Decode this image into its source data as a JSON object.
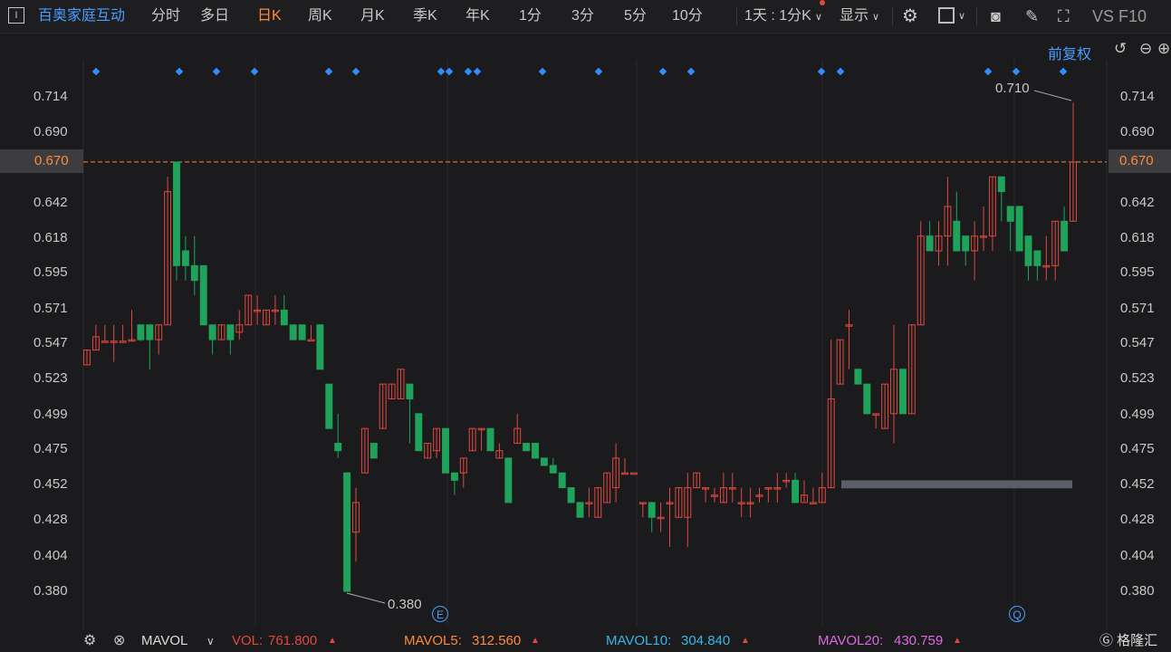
{
  "toolbar": {
    "stock_name": "百奥家庭互动",
    "tabs": [
      "分时",
      "多日",
      "日K",
      "周K",
      "月K",
      "季K",
      "年K",
      "1分",
      "3分",
      "5分",
      "10分"
    ],
    "active_tab": "日K",
    "interval_select": "1天 : 1分K",
    "display_menu": "显示",
    "right_label": "VS F10"
  },
  "chart_header": {
    "adjust_mode": "前复权"
  },
  "price_axis": {
    "ticks": [
      "0.714",
      "0.690",
      "0.670",
      "0.642",
      "0.618",
      "0.595",
      "0.571",
      "0.547",
      "0.523",
      "0.499",
      "0.475",
      "0.452",
      "0.428",
      "0.404",
      "0.380"
    ],
    "current_price": "0.670"
  },
  "annotations": {
    "max_label": "0.710",
    "min_label": "0.380",
    "marker_e": "E",
    "marker_q": "Q"
  },
  "status_bar": {
    "indicator": "MAVOL",
    "vol_label": "VOL:",
    "vol_value": "761.800",
    "mavol5_label": "MAVOL5:",
    "mavol5_value": "312.560",
    "mavol10_label": "MAVOL10:",
    "mavol10_value": "304.840",
    "mavol20_label": "MAVOL20:",
    "mavol20_value": "430.759"
  },
  "watermark": "格隆汇",
  "colors": {
    "up": "#e0483e",
    "down": "#1fa35a",
    "accent": "#2f8fff",
    "current_line": "#ff8a3d"
  },
  "chart_data": {
    "type": "candlestick",
    "ylim": [
      0.37,
      0.725
    ],
    "ohlc": [
      [
        0.533,
        0.543,
        0.543,
        0.533
      ],
      [
        0.543,
        0.56,
        0.552,
        0.543
      ],
      [
        0.549,
        0.56,
        0.549,
        0.549
      ],
      [
        0.549,
        0.56,
        0.549,
        0.535
      ],
      [
        0.549,
        0.56,
        0.549,
        0.549
      ],
      [
        0.549,
        0.57,
        0.55,
        0.549
      ],
      [
        0.56,
        0.56,
        0.55,
        0.549
      ],
      [
        0.56,
        0.56,
        0.55,
        0.53
      ],
      [
        0.55,
        0.56,
        0.56,
        0.54
      ],
      [
        0.56,
        0.66,
        0.65,
        0.56
      ],
      [
        0.67,
        0.67,
        0.6,
        0.59
      ],
      [
        0.61,
        0.62,
        0.6,
        0.59
      ],
      [
        0.6,
        0.62,
        0.59,
        0.58
      ],
      [
        0.6,
        0.6,
        0.56,
        0.56
      ],
      [
        0.56,
        0.56,
        0.55,
        0.54
      ],
      [
        0.55,
        0.56,
        0.56,
        0.55
      ],
      [
        0.56,
        0.56,
        0.55,
        0.54
      ],
      [
        0.555,
        0.57,
        0.56,
        0.55
      ],
      [
        0.56,
        0.58,
        0.58,
        0.56
      ],
      [
        0.57,
        0.58,
        0.57,
        0.56
      ],
      [
        0.56,
        0.57,
        0.57,
        0.56
      ],
      [
        0.57,
        0.58,
        0.57,
        0.56
      ],
      [
        0.57,
        0.58,
        0.56,
        0.56
      ],
      [
        0.56,
        0.56,
        0.55,
        0.55
      ],
      [
        0.56,
        0.56,
        0.55,
        0.55
      ],
      [
        0.55,
        0.56,
        0.55,
        0.55
      ],
      [
        0.56,
        0.56,
        0.53,
        0.53
      ],
      [
        0.52,
        0.52,
        0.49,
        0.49
      ],
      [
        0.48,
        0.5,
        0.475,
        0.47
      ],
      [
        0.46,
        0.46,
        0.38,
        0.38
      ],
      [
        0.42,
        0.45,
        0.44,
        0.4
      ],
      [
        0.46,
        0.49,
        0.49,
        0.46
      ],
      [
        0.48,
        0.48,
        0.47,
        0.47
      ],
      [
        0.49,
        0.52,
        0.52,
        0.49
      ],
      [
        0.51,
        0.52,
        0.52,
        0.51
      ],
      [
        0.51,
        0.53,
        0.53,
        0.51
      ],
      [
        0.52,
        0.52,
        0.51,
        0.48
      ],
      [
        0.5,
        0.5,
        0.475,
        0.475
      ],
      [
        0.47,
        0.48,
        0.48,
        0.47
      ],
      [
        0.475,
        0.49,
        0.49,
        0.47
      ],
      [
        0.49,
        0.49,
        0.46,
        0.46
      ],
      [
        0.46,
        0.46,
        0.455,
        0.445
      ],
      [
        0.46,
        0.47,
        0.47,
        0.45
      ],
      [
        0.475,
        0.49,
        0.49,
        0.475
      ],
      [
        0.49,
        0.49,
        0.49,
        0.475
      ],
      [
        0.49,
        0.49,
        0.475,
        0.475
      ],
      [
        0.47,
        0.48,
        0.475,
        0.47
      ],
      [
        0.47,
        0.47,
        0.44,
        0.44
      ],
      [
        0.48,
        0.5,
        0.49,
        0.48
      ],
      [
        0.48,
        0.48,
        0.475,
        0.475
      ],
      [
        0.48,
        0.48,
        0.47,
        0.47
      ],
      [
        0.47,
        0.47,
        0.465,
        0.465
      ],
      [
        0.465,
        0.47,
        0.46,
        0.46
      ],
      [
        0.46,
        0.46,
        0.45,
        0.45
      ],
      [
        0.45,
        0.45,
        0.44,
        0.44
      ],
      [
        0.44,
        0.44,
        0.43,
        0.43
      ],
      [
        0.44,
        0.45,
        0.44,
        0.43
      ],
      [
        0.43,
        0.45,
        0.45,
        0.43
      ],
      [
        0.44,
        0.46,
        0.46,
        0.44
      ],
      [
        0.45,
        0.48,
        0.47,
        0.44
      ],
      [
        0.46,
        0.47,
        0.46,
        0.46
      ],
      [
        0.46,
        0.46,
        0.46,
        0.46
      ],
      [
        0.44,
        0.44,
        0.44,
        0.43
      ],
      [
        0.44,
        0.44,
        0.43,
        0.42
      ],
      [
        0.43,
        0.44,
        0.43,
        0.42
      ],
      [
        0.44,
        0.45,
        0.44,
        0.41
      ],
      [
        0.43,
        0.45,
        0.45,
        0.43
      ],
      [
        0.43,
        0.46,
        0.45,
        0.41
      ],
      [
        0.45,
        0.46,
        0.46,
        0.45
      ],
      [
        0.45,
        0.45,
        0.45,
        0.44
      ],
      [
        0.445,
        0.45,
        0.445,
        0.44
      ],
      [
        0.44,
        0.46,
        0.45,
        0.44
      ],
      [
        0.45,
        0.46,
        0.45,
        0.44
      ],
      [
        0.44,
        0.45,
        0.44,
        0.43
      ],
      [
        0.44,
        0.45,
        0.44,
        0.43
      ],
      [
        0.445,
        0.45,
        0.445,
        0.44
      ],
      [
        0.45,
        0.45,
        0.45,
        0.44
      ],
      [
        0.45,
        0.46,
        0.45,
        0.44
      ],
      [
        0.455,
        0.46,
        0.455,
        0.45
      ],
      [
        0.455,
        0.46,
        0.44,
        0.44
      ],
      [
        0.44,
        0.455,
        0.445,
        0.44
      ],
      [
        0.44,
        0.45,
        0.44,
        0.44
      ],
      [
        0.44,
        0.46,
        0.45,
        0.44
      ],
      [
        0.45,
        0.55,
        0.51,
        0.45
      ],
      [
        0.52,
        0.55,
        0.55,
        0.52
      ],
      [
        0.56,
        0.57,
        0.56,
        0.53
      ],
      [
        0.53,
        0.53,
        0.52,
        0.52
      ],
      [
        0.52,
        0.52,
        0.5,
        0.5
      ],
      [
        0.5,
        0.5,
        0.5,
        0.49
      ],
      [
        0.49,
        0.52,
        0.52,
        0.49
      ],
      [
        0.5,
        0.56,
        0.53,
        0.48
      ],
      [
        0.53,
        0.53,
        0.5,
        0.5
      ],
      [
        0.5,
        0.56,
        0.56,
        0.5
      ],
      [
        0.56,
        0.63,
        0.62,
        0.56
      ],
      [
        0.62,
        0.63,
        0.61,
        0.61
      ],
      [
        0.61,
        0.63,
        0.62,
        0.6
      ],
      [
        0.62,
        0.66,
        0.64,
        0.6
      ],
      [
        0.63,
        0.65,
        0.61,
        0.61
      ],
      [
        0.62,
        0.62,
        0.61,
        0.6
      ],
      [
        0.61,
        0.63,
        0.62,
        0.59
      ],
      [
        0.62,
        0.64,
        0.62,
        0.61
      ],
      [
        0.62,
        0.66,
        0.66,
        0.61
      ],
      [
        0.66,
        0.66,
        0.65,
        0.63
      ],
      [
        0.64,
        0.64,
        0.63,
        0.61
      ],
      [
        0.64,
        0.64,
        0.61,
        0.61
      ],
      [
        0.62,
        0.62,
        0.6,
        0.59
      ],
      [
        0.61,
        0.61,
        0.6,
        0.59
      ],
      [
        0.6,
        0.62,
        0.6,
        0.59
      ],
      [
        0.6,
        0.63,
        0.63,
        0.59
      ],
      [
        0.63,
        0.64,
        0.61,
        0.61
      ],
      [
        0.63,
        0.71,
        0.67,
        0.63
      ]
    ],
    "volume_bands": [
      0.452,
      0.455
    ]
  }
}
